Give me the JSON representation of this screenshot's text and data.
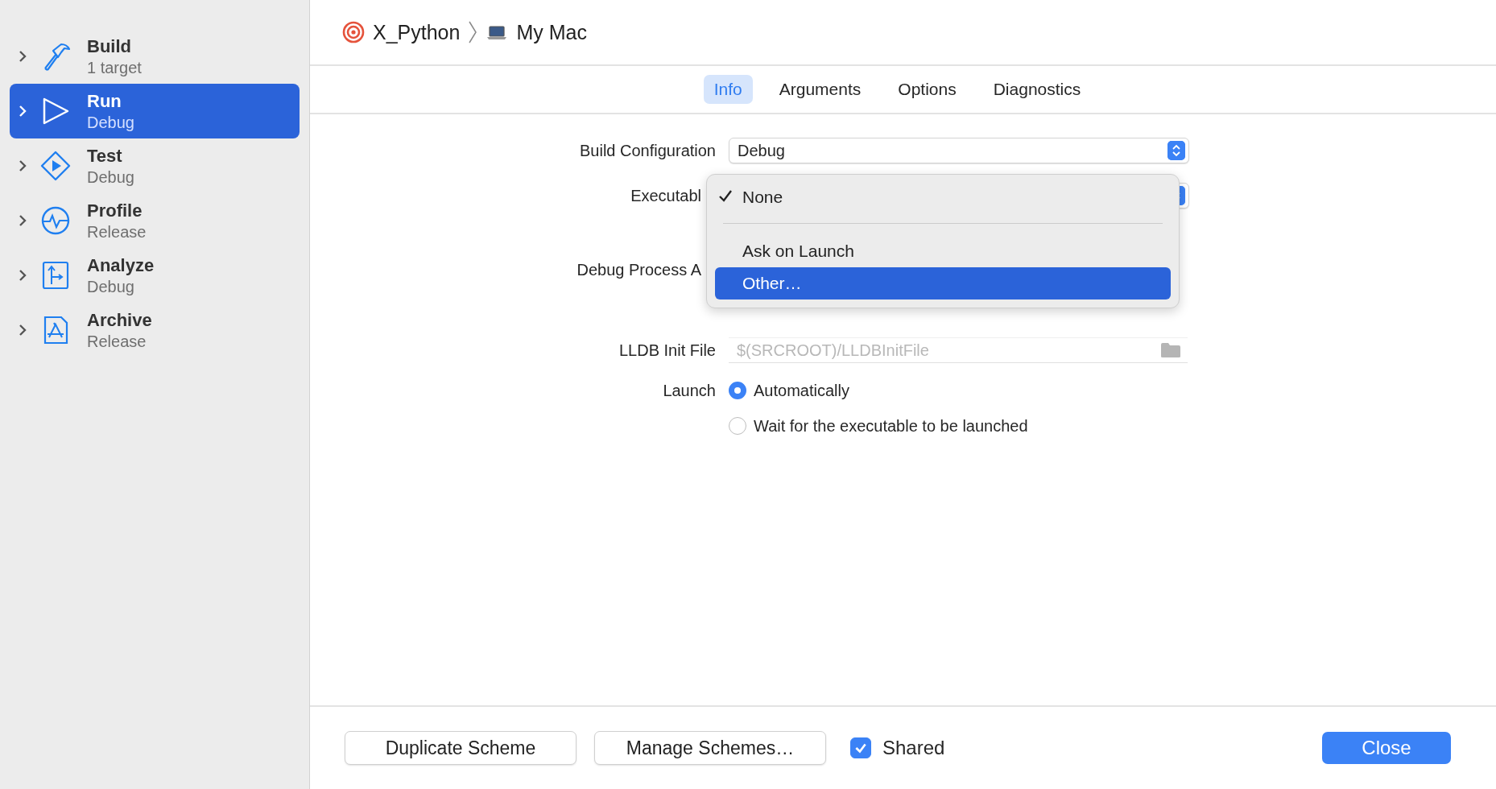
{
  "sidebar": {
    "items": [
      {
        "title": "Build",
        "subtitle": "1 target",
        "kind": "hammer",
        "selected": false
      },
      {
        "title": "Run",
        "subtitle": "Debug",
        "kind": "play",
        "selected": true
      },
      {
        "title": "Test",
        "subtitle": "Debug",
        "kind": "diamond",
        "selected": false
      },
      {
        "title": "Profile",
        "subtitle": "Release",
        "kind": "gauge",
        "selected": false
      },
      {
        "title": "Analyze",
        "subtitle": "Debug",
        "kind": "branch",
        "selected": false
      },
      {
        "title": "Archive",
        "subtitle": "Release",
        "kind": "archive",
        "selected": false
      }
    ]
  },
  "breadcrumb": [
    {
      "label": "X_Python"
    },
    {
      "label": "My Mac"
    }
  ],
  "tabs": [
    {
      "label": "Info",
      "selected": true
    },
    {
      "label": "Arguments",
      "selected": false
    },
    {
      "label": "Options",
      "selected": false
    },
    {
      "label": "Diagnostics",
      "selected": false
    }
  ],
  "form": {
    "build_configuration": {
      "label": "Build Configuration",
      "value": "Debug"
    },
    "executable": {
      "label": "Executabl"
    },
    "debug_process": {
      "label": "Debug Process A"
    },
    "lldb_init_file": {
      "label": "LLDB Init File",
      "placeholder": "$(SRCROOT)/LLDBInitFile"
    },
    "launch": {
      "label": "Launch",
      "options": [
        {
          "label": "Automatically",
          "selected": true
        },
        {
          "label": "Wait for the executable to be launched",
          "selected": false
        }
      ]
    }
  },
  "menu": {
    "items": [
      {
        "kind": "item",
        "label": "None",
        "checked": true,
        "selected": false
      },
      {
        "kind": "separator"
      },
      {
        "kind": "item",
        "label": "Ask on Launch",
        "checked": false,
        "selected": false
      },
      {
        "kind": "item",
        "label": "Other…",
        "checked": false,
        "selected": true
      }
    ]
  },
  "footer": {
    "buttons": [
      "Duplicate Scheme",
      "Manage Schemes…"
    ],
    "shared": {
      "label": "Shared",
      "checked": true
    },
    "close": "Close"
  }
}
